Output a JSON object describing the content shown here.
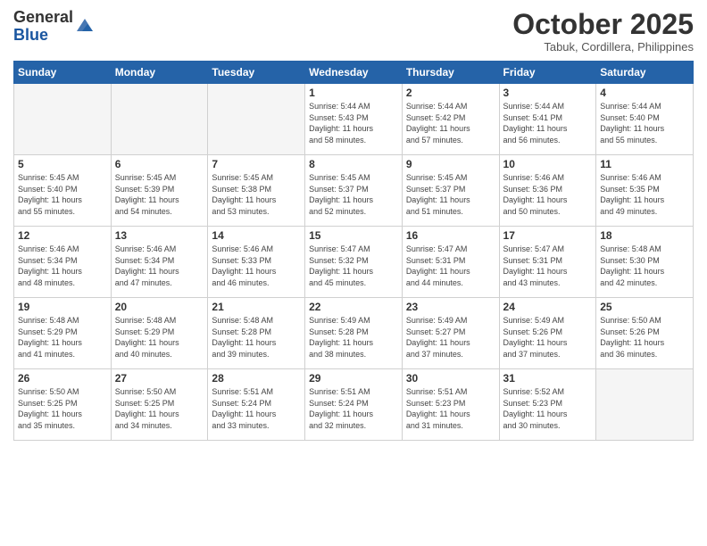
{
  "header": {
    "logo_general": "General",
    "logo_blue": "Blue",
    "month_title": "October 2025",
    "location": "Tabuk, Cordillera, Philippines"
  },
  "weekdays": [
    "Sunday",
    "Monday",
    "Tuesday",
    "Wednesday",
    "Thursday",
    "Friday",
    "Saturday"
  ],
  "weeks": [
    [
      {
        "day": "",
        "info": ""
      },
      {
        "day": "",
        "info": ""
      },
      {
        "day": "",
        "info": ""
      },
      {
        "day": "1",
        "info": "Sunrise: 5:44 AM\nSunset: 5:43 PM\nDaylight: 11 hours\nand 58 minutes."
      },
      {
        "day": "2",
        "info": "Sunrise: 5:44 AM\nSunset: 5:42 PM\nDaylight: 11 hours\nand 57 minutes."
      },
      {
        "day": "3",
        "info": "Sunrise: 5:44 AM\nSunset: 5:41 PM\nDaylight: 11 hours\nand 56 minutes."
      },
      {
        "day": "4",
        "info": "Sunrise: 5:44 AM\nSunset: 5:40 PM\nDaylight: 11 hours\nand 55 minutes."
      }
    ],
    [
      {
        "day": "5",
        "info": "Sunrise: 5:45 AM\nSunset: 5:40 PM\nDaylight: 11 hours\nand 55 minutes."
      },
      {
        "day": "6",
        "info": "Sunrise: 5:45 AM\nSunset: 5:39 PM\nDaylight: 11 hours\nand 54 minutes."
      },
      {
        "day": "7",
        "info": "Sunrise: 5:45 AM\nSunset: 5:38 PM\nDaylight: 11 hours\nand 53 minutes."
      },
      {
        "day": "8",
        "info": "Sunrise: 5:45 AM\nSunset: 5:37 PM\nDaylight: 11 hours\nand 52 minutes."
      },
      {
        "day": "9",
        "info": "Sunrise: 5:45 AM\nSunset: 5:37 PM\nDaylight: 11 hours\nand 51 minutes."
      },
      {
        "day": "10",
        "info": "Sunrise: 5:46 AM\nSunset: 5:36 PM\nDaylight: 11 hours\nand 50 minutes."
      },
      {
        "day": "11",
        "info": "Sunrise: 5:46 AM\nSunset: 5:35 PM\nDaylight: 11 hours\nand 49 minutes."
      }
    ],
    [
      {
        "day": "12",
        "info": "Sunrise: 5:46 AM\nSunset: 5:34 PM\nDaylight: 11 hours\nand 48 minutes."
      },
      {
        "day": "13",
        "info": "Sunrise: 5:46 AM\nSunset: 5:34 PM\nDaylight: 11 hours\nand 47 minutes."
      },
      {
        "day": "14",
        "info": "Sunrise: 5:46 AM\nSunset: 5:33 PM\nDaylight: 11 hours\nand 46 minutes."
      },
      {
        "day": "15",
        "info": "Sunrise: 5:47 AM\nSunset: 5:32 PM\nDaylight: 11 hours\nand 45 minutes."
      },
      {
        "day": "16",
        "info": "Sunrise: 5:47 AM\nSunset: 5:31 PM\nDaylight: 11 hours\nand 44 minutes."
      },
      {
        "day": "17",
        "info": "Sunrise: 5:47 AM\nSunset: 5:31 PM\nDaylight: 11 hours\nand 43 minutes."
      },
      {
        "day": "18",
        "info": "Sunrise: 5:48 AM\nSunset: 5:30 PM\nDaylight: 11 hours\nand 42 minutes."
      }
    ],
    [
      {
        "day": "19",
        "info": "Sunrise: 5:48 AM\nSunset: 5:29 PM\nDaylight: 11 hours\nand 41 minutes."
      },
      {
        "day": "20",
        "info": "Sunrise: 5:48 AM\nSunset: 5:29 PM\nDaylight: 11 hours\nand 40 minutes."
      },
      {
        "day": "21",
        "info": "Sunrise: 5:48 AM\nSunset: 5:28 PM\nDaylight: 11 hours\nand 39 minutes."
      },
      {
        "day": "22",
        "info": "Sunrise: 5:49 AM\nSunset: 5:28 PM\nDaylight: 11 hours\nand 38 minutes."
      },
      {
        "day": "23",
        "info": "Sunrise: 5:49 AM\nSunset: 5:27 PM\nDaylight: 11 hours\nand 37 minutes."
      },
      {
        "day": "24",
        "info": "Sunrise: 5:49 AM\nSunset: 5:26 PM\nDaylight: 11 hours\nand 37 minutes."
      },
      {
        "day": "25",
        "info": "Sunrise: 5:50 AM\nSunset: 5:26 PM\nDaylight: 11 hours\nand 36 minutes."
      }
    ],
    [
      {
        "day": "26",
        "info": "Sunrise: 5:50 AM\nSunset: 5:25 PM\nDaylight: 11 hours\nand 35 minutes."
      },
      {
        "day": "27",
        "info": "Sunrise: 5:50 AM\nSunset: 5:25 PM\nDaylight: 11 hours\nand 34 minutes."
      },
      {
        "day": "28",
        "info": "Sunrise: 5:51 AM\nSunset: 5:24 PM\nDaylight: 11 hours\nand 33 minutes."
      },
      {
        "day": "29",
        "info": "Sunrise: 5:51 AM\nSunset: 5:24 PM\nDaylight: 11 hours\nand 32 minutes."
      },
      {
        "day": "30",
        "info": "Sunrise: 5:51 AM\nSunset: 5:23 PM\nDaylight: 11 hours\nand 31 minutes."
      },
      {
        "day": "31",
        "info": "Sunrise: 5:52 AM\nSunset: 5:23 PM\nDaylight: 11 hours\nand 30 minutes."
      },
      {
        "day": "",
        "info": ""
      }
    ]
  ]
}
